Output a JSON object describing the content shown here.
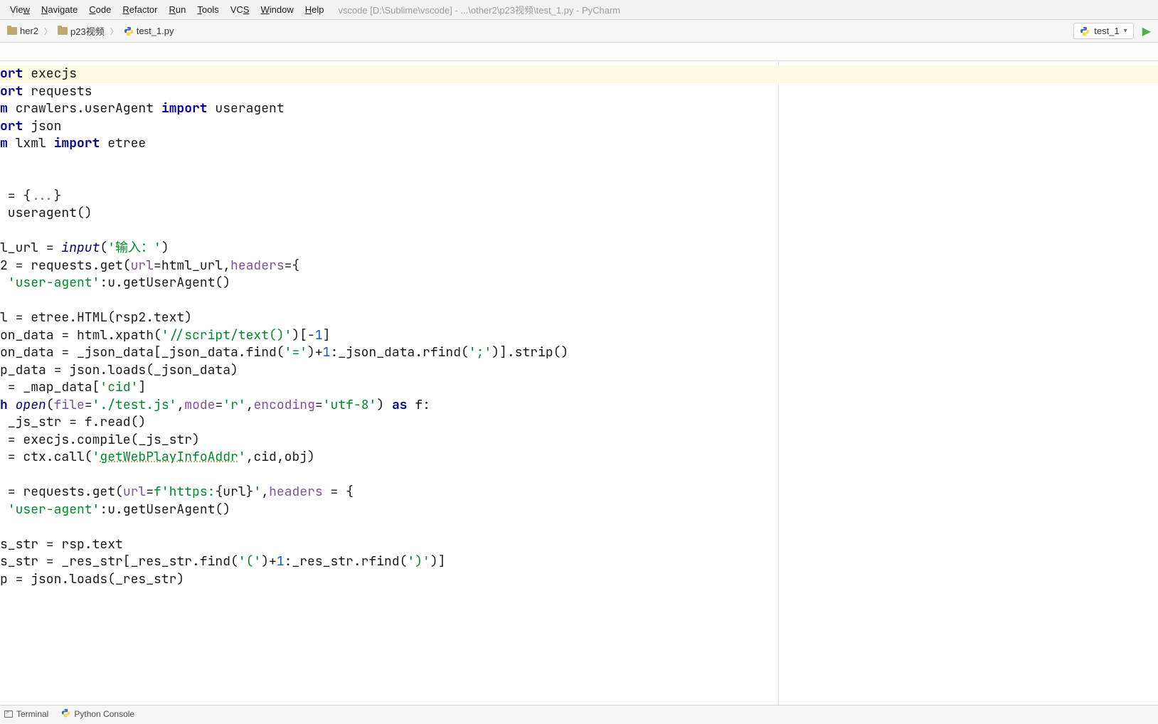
{
  "menu": {
    "items": [
      "View",
      "Navigate",
      "Code",
      "Refactor",
      "Run",
      "Tools",
      "VCS",
      "Window",
      "Help"
    ],
    "underline_idx": [
      3,
      0,
      0,
      0,
      0,
      0,
      2,
      0,
      0
    ]
  },
  "window_title": "vscode [D:\\Sublime\\vscode] - ...\\other2\\p23视频\\test_1.py - PyCharm",
  "breadcrumb": {
    "items": [
      {
        "label": "her2",
        "icon": "folder"
      },
      {
        "label": "p23视频",
        "icon": "folder"
      },
      {
        "label": "test_1.py",
        "icon": "python"
      }
    ]
  },
  "run_config": {
    "label": "test_1"
  },
  "code": {
    "lines": [
      {
        "hl": true,
        "segs": [
          {
            "t": "ort ",
            "c": "kw"
          },
          {
            "t": "execjs",
            "c": "plain"
          }
        ]
      },
      {
        "segs": [
          {
            "t": "ort ",
            "c": "kw"
          },
          {
            "t": "requests",
            "c": "plain"
          }
        ]
      },
      {
        "segs": [
          {
            "t": "m ",
            "c": "kw"
          },
          {
            "t": "crawlers.userAgent ",
            "c": "plain"
          },
          {
            "t": "import ",
            "c": "kw"
          },
          {
            "t": "useragent",
            "c": "plain"
          }
        ]
      },
      {
        "segs": [
          {
            "t": "ort ",
            "c": "kw"
          },
          {
            "t": "json",
            "c": "plain"
          }
        ]
      },
      {
        "segs": [
          {
            "t": "m ",
            "c": "kw"
          },
          {
            "t": "lxml ",
            "c": "plain"
          },
          {
            "t": "import ",
            "c": "kw"
          },
          {
            "t": "etree",
            "c": "plain"
          }
        ]
      },
      {
        "segs": [
          {
            "t": "",
            "c": "plain"
          }
        ]
      },
      {
        "segs": [
          {
            "t": "",
            "c": "plain"
          }
        ]
      },
      {
        "segs": [
          {
            "t": " = ",
            "c": "plain"
          },
          {
            "t": "{",
            "c": "plain"
          },
          {
            "t": "...",
            "c": "soft"
          },
          {
            "t": "}",
            "c": "plain"
          }
        ]
      },
      {
        "segs": [
          {
            "t": " useragent()",
            "c": "plain"
          }
        ]
      },
      {
        "segs": [
          {
            "t": "",
            "c": "plain"
          }
        ]
      },
      {
        "segs": [
          {
            "t": "l_url = ",
            "c": "plain"
          },
          {
            "t": "input",
            "c": "bi"
          },
          {
            "t": "(",
            "c": "plain"
          },
          {
            "t": "'输入：'",
            "c": "str"
          },
          {
            "t": ")",
            "c": "plain"
          }
        ]
      },
      {
        "segs": [
          {
            "t": "2 = requests.get(",
            "c": "plain"
          },
          {
            "t": "url",
            "c": "kwarg"
          },
          {
            "t": "=html_url,",
            "c": "plain"
          },
          {
            "t": "headers",
            "c": "kwarg"
          },
          {
            "t": "={",
            "c": "plain"
          }
        ]
      },
      {
        "segs": [
          {
            "t": " ",
            "c": "plain"
          },
          {
            "t": "'user-agent'",
            "c": "str"
          },
          {
            "t": ":u.getUserAgent()",
            "c": "plain"
          }
        ]
      },
      {
        "segs": [
          {
            "t": "",
            "c": "plain"
          }
        ]
      },
      {
        "segs": [
          {
            "t": "l = etree.HTML(rsp2.text)",
            "c": "plain"
          }
        ]
      },
      {
        "segs": [
          {
            "t": "on_data = html.xpath(",
            "c": "plain"
          },
          {
            "t": "'//script/text()'",
            "c": "str"
          },
          {
            "t": ")[-",
            "c": "plain"
          },
          {
            "t": "1",
            "c": "num"
          },
          {
            "t": "]",
            "c": "plain"
          }
        ]
      },
      {
        "segs": [
          {
            "t": "on_data = _json_data[_json_data.find(",
            "c": "plain"
          },
          {
            "t": "'='",
            "c": "str"
          },
          {
            "t": ")+",
            "c": "plain"
          },
          {
            "t": "1",
            "c": "num"
          },
          {
            "t": ":_json_data.rfind(",
            "c": "plain"
          },
          {
            "t": "';'",
            "c": "str"
          },
          {
            "t": ")].strip()",
            "c": "plain"
          }
        ]
      },
      {
        "segs": [
          {
            "t": "p_data = json.loads(_json_data)",
            "c": "plain"
          }
        ]
      },
      {
        "segs": [
          {
            "t": " = _map_data[",
            "c": "plain"
          },
          {
            "t": "'cid'",
            "c": "str"
          },
          {
            "t": "]",
            "c": "plain"
          }
        ]
      },
      {
        "segs": [
          {
            "t": "h ",
            "c": "kw"
          },
          {
            "t": "open",
            "c": "bi"
          },
          {
            "t": "(",
            "c": "plain"
          },
          {
            "t": "file",
            "c": "kwarg"
          },
          {
            "t": "=",
            "c": "plain"
          },
          {
            "t": "'./test.js'",
            "c": "str"
          },
          {
            "t": ",",
            "c": "plain"
          },
          {
            "t": "mode",
            "c": "kwarg"
          },
          {
            "t": "=",
            "c": "plain"
          },
          {
            "t": "'r'",
            "c": "str"
          },
          {
            "t": ",",
            "c": "plain"
          },
          {
            "t": "encoding",
            "c": "kwarg"
          },
          {
            "t": "=",
            "c": "plain"
          },
          {
            "t": "'utf-8'",
            "c": "str"
          },
          {
            "t": ") ",
            "c": "plain"
          },
          {
            "t": "as ",
            "c": "kw"
          },
          {
            "t": "f:",
            "c": "plain"
          }
        ]
      },
      {
        "segs": [
          {
            "t": " _js_str = f.read()",
            "c": "plain"
          }
        ]
      },
      {
        "segs": [
          {
            "t": " = execjs.compile(_js_str)",
            "c": "plain"
          }
        ]
      },
      {
        "segs": [
          {
            "t": " = ctx.call(",
            "c": "plain"
          },
          {
            "t": "'",
            "c": "str"
          },
          {
            "t": "getWebPlayInfoAddr",
            "c": "str undersquiggle"
          },
          {
            "t": "'",
            "c": "str"
          },
          {
            "t": ",cid,obj)",
            "c": "plain"
          }
        ]
      },
      {
        "segs": [
          {
            "t": "",
            "c": "plain"
          }
        ]
      },
      {
        "segs": [
          {
            "t": " = requests.get(",
            "c": "plain"
          },
          {
            "t": "url",
            "c": "kwarg"
          },
          {
            "t": "=",
            "c": "plain"
          },
          {
            "t": "f'https:",
            "c": "strf"
          },
          {
            "t": "{",
            "c": "plain"
          },
          {
            "t": "url",
            "c": "plain"
          },
          {
            "t": "}",
            "c": "plain"
          },
          {
            "t": "'",
            "c": "strf"
          },
          {
            "t": ",",
            "c": "plain"
          },
          {
            "t": "headers ",
            "c": "kwarg"
          },
          {
            "t": "= {",
            "c": "plain"
          }
        ]
      },
      {
        "segs": [
          {
            "t": " ",
            "c": "plain"
          },
          {
            "t": "'user-agent'",
            "c": "str"
          },
          {
            "t": ":u.getUserAgent()",
            "c": "plain"
          }
        ]
      },
      {
        "segs": [
          {
            "t": "",
            "c": "plain"
          }
        ]
      },
      {
        "segs": [
          {
            "t": "s_str = rsp.text",
            "c": "plain"
          }
        ]
      },
      {
        "segs": [
          {
            "t": "s_str = _res_str[_res_str.find(",
            "c": "plain"
          },
          {
            "t": "'('",
            "c": "str"
          },
          {
            "t": ")+",
            "c": "plain"
          },
          {
            "t": "1",
            "c": "num"
          },
          {
            "t": ":_res_str.rfind(",
            "c": "plain"
          },
          {
            "t": "')'",
            "c": "str"
          },
          {
            "t": ")]",
            "c": "plain"
          }
        ]
      },
      {
        "segs": [
          {
            "t": "p = json.loads(_res_str)",
            "c": "plain"
          }
        ]
      }
    ]
  },
  "bottom_tools": {
    "terminal": "Terminal",
    "console": "Python Console"
  }
}
